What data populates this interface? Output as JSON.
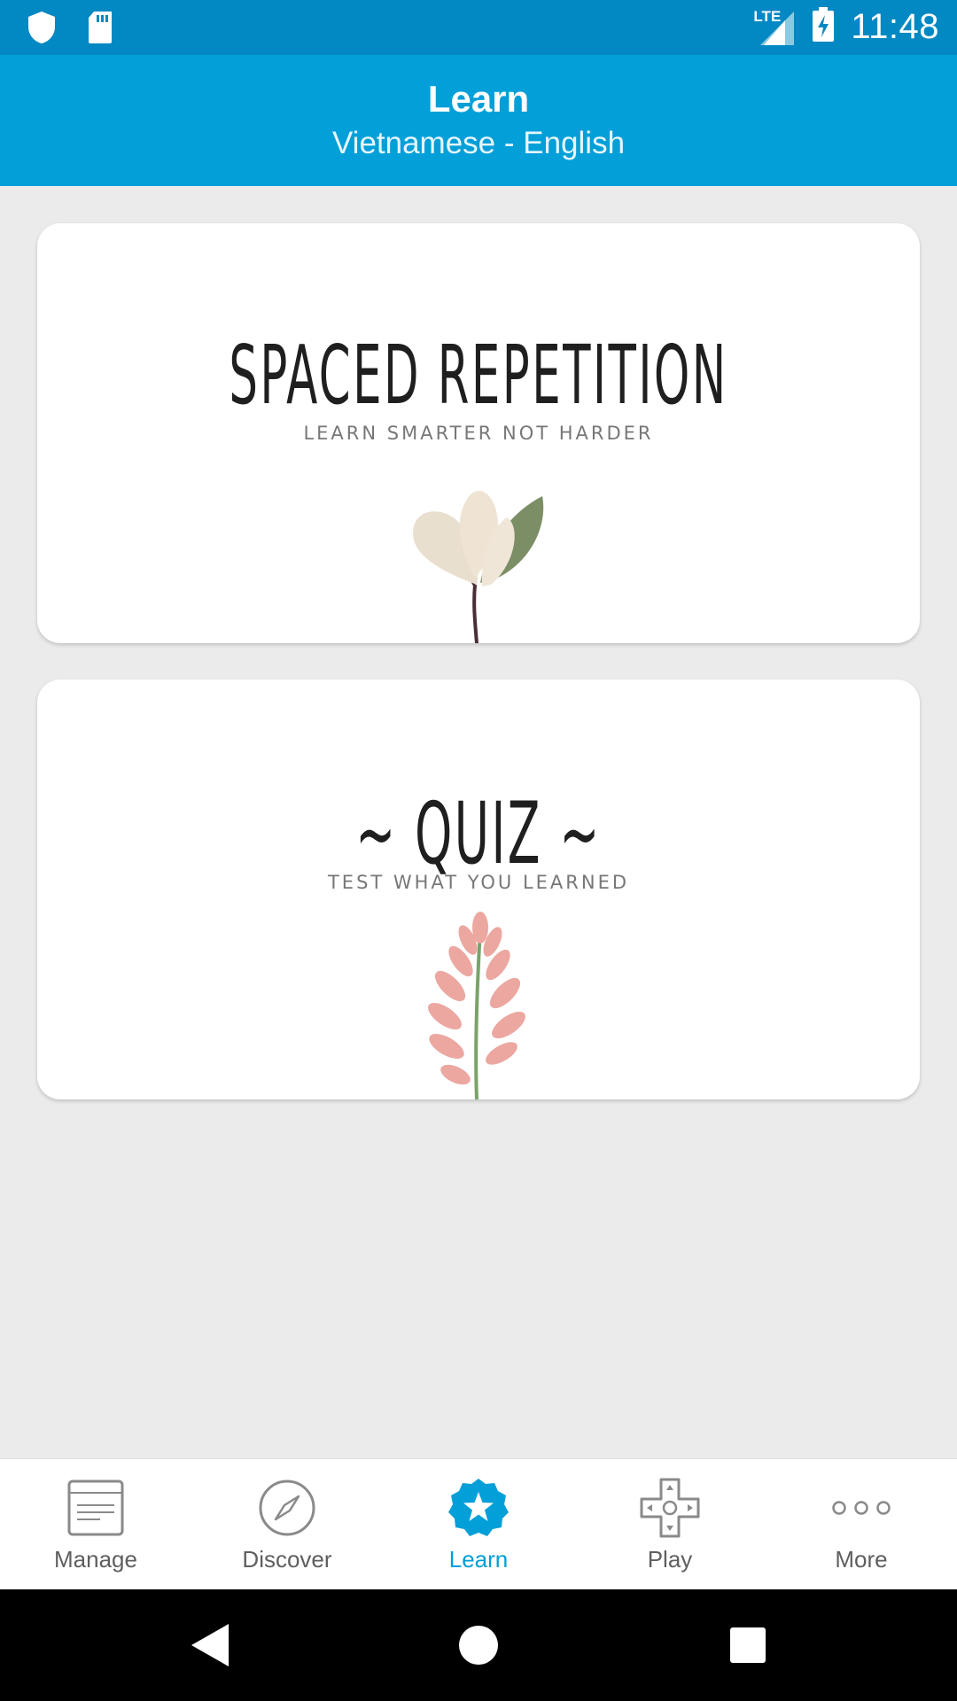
{
  "status_bar": {
    "time": "11:48",
    "network": "LTE",
    "icons": [
      "shield-icon",
      "sd-card-icon",
      "signal-icon",
      "battery-charging-icon"
    ]
  },
  "app_bar": {
    "title": "Learn",
    "subtitle": "Vietnamese - English",
    "background": "#029fd8"
  },
  "cards": [
    {
      "title": "SPACED REPETITION",
      "subtitle": "LEARN SMARTER NOT HARDER",
      "art": "magnolia-leaves-illustration"
    },
    {
      "title": "~ QUIZ ~",
      "subtitle": "TEST WHAT YOU LEARNED",
      "art": "pink-flower-stem-illustration"
    }
  ],
  "bottom_nav": {
    "active": "Learn",
    "active_color": "#029fd8",
    "items": [
      {
        "label": "Manage",
        "icon": "document-icon"
      },
      {
        "label": "Discover",
        "icon": "compass-icon"
      },
      {
        "label": "Learn",
        "icon": "star-badge-icon"
      },
      {
        "label": "Play",
        "icon": "gamepad-icon"
      },
      {
        "label": "More",
        "icon": "more-dots-icon"
      }
    ]
  },
  "system_nav": [
    "back-icon",
    "home-icon",
    "recents-icon"
  ]
}
